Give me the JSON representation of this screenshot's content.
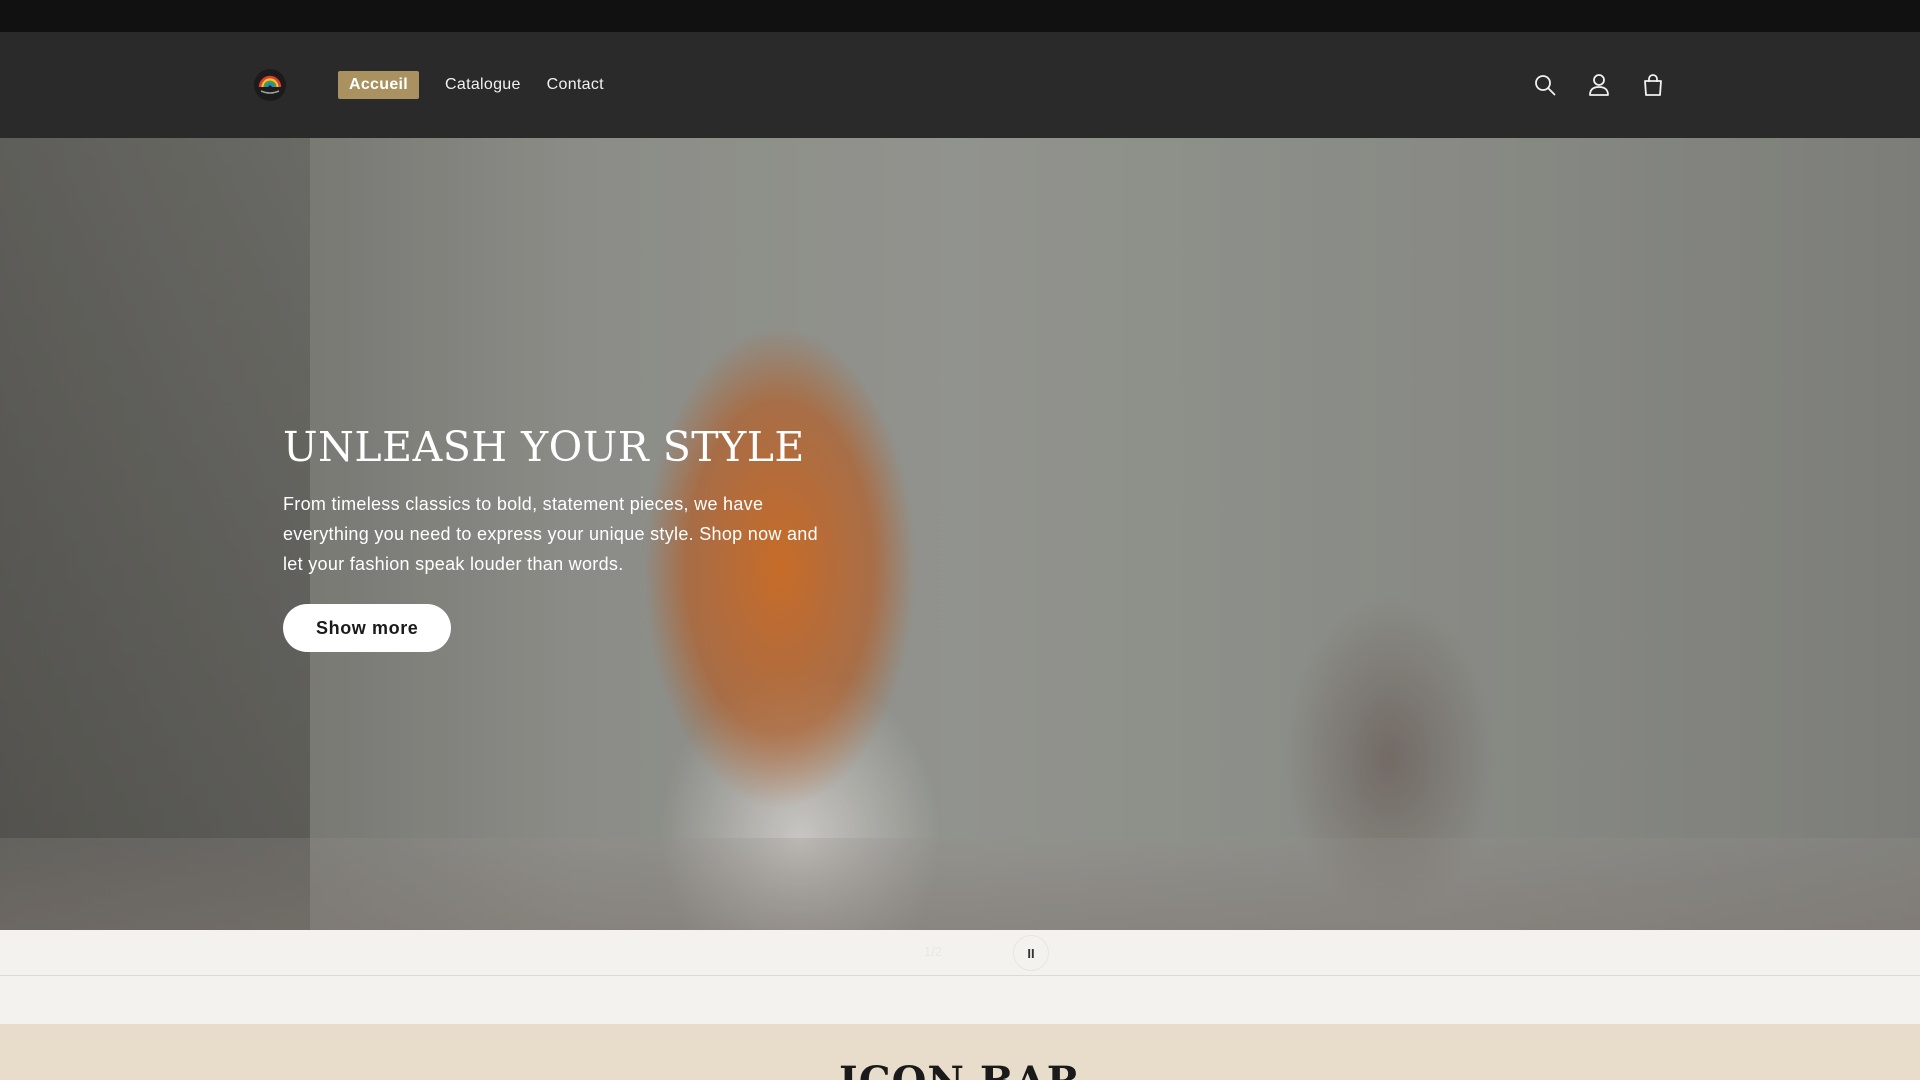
{
  "header": {
    "logo_icon": "rainbow-logo-icon",
    "nav": [
      {
        "label": "Accueil",
        "active": true
      },
      {
        "label": "Catalogue",
        "active": false
      },
      {
        "label": "Contact",
        "active": false
      }
    ],
    "icons": [
      "search-icon",
      "account-icon",
      "cart-icon"
    ],
    "active_color": "#a9925f"
  },
  "hero": {
    "title": "UNLEASH YOUR STYLE",
    "text": "From timeless classics to bold, statement pieces, we have everything you need to express your unique style. Shop now and let your fashion speak louder than words.",
    "button_label": "Show more"
  },
  "slider": {
    "counter": "1/2",
    "pause_label": "II"
  },
  "icon_bar": {
    "title": "ICON BAR"
  }
}
